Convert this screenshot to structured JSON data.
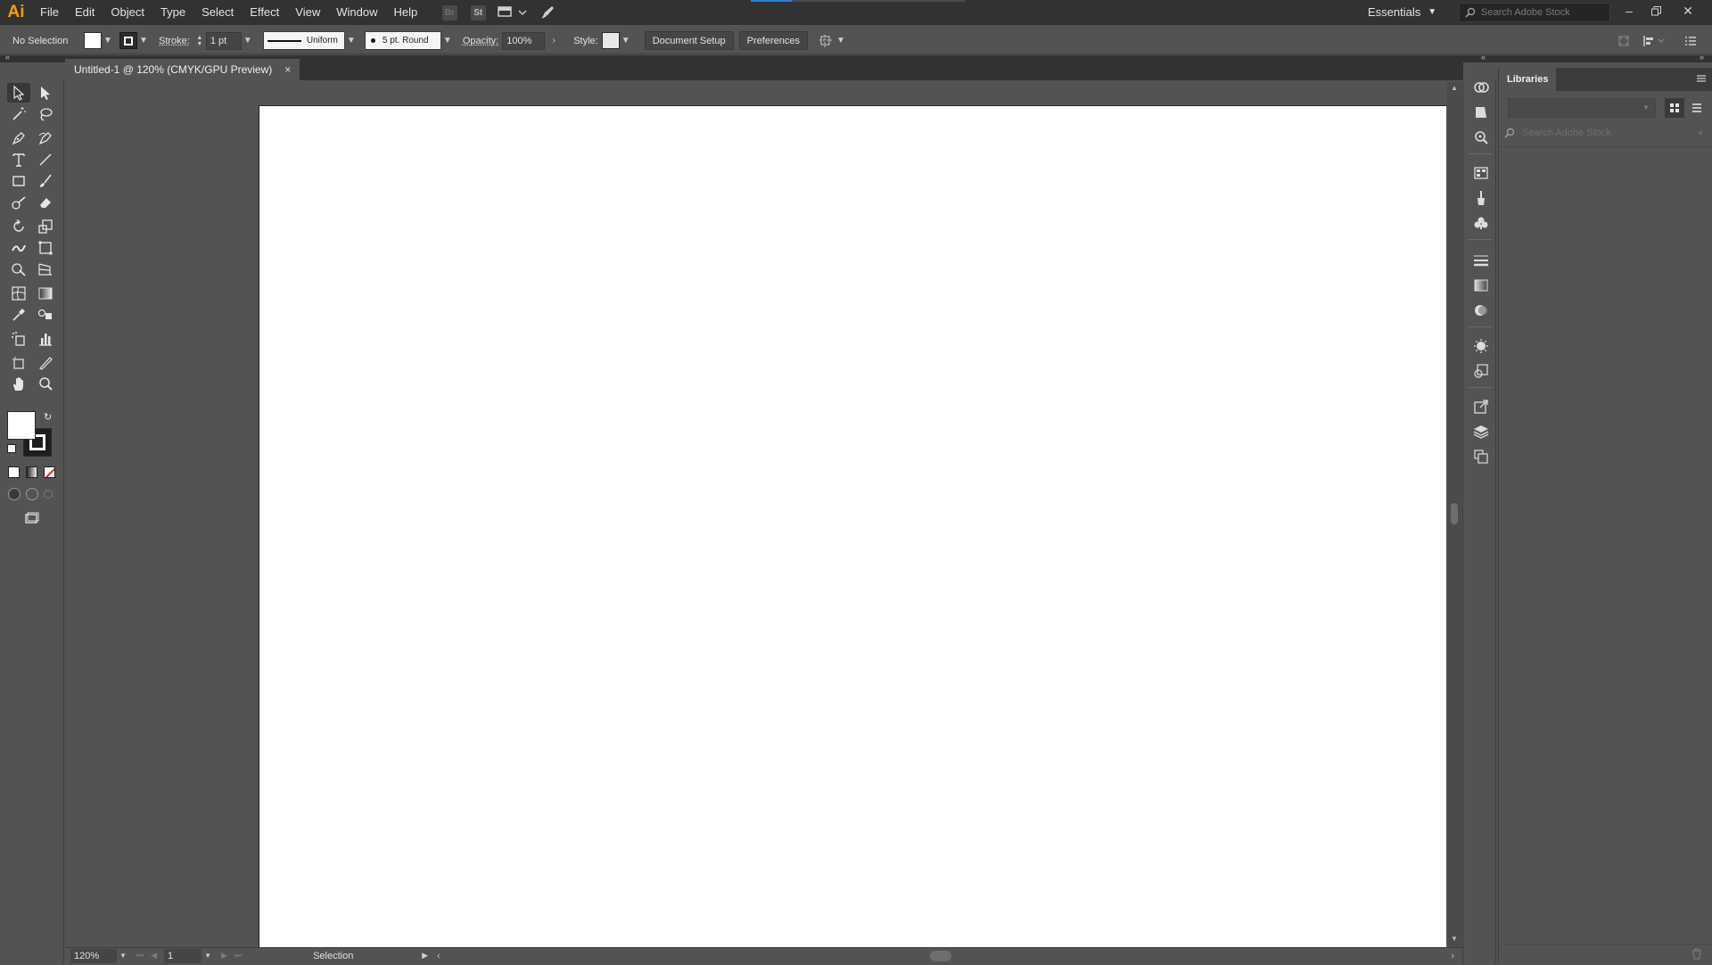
{
  "app": {
    "logo": "Ai"
  },
  "menu": [
    "File",
    "Edit",
    "Object",
    "Type",
    "Select",
    "Effect",
    "View",
    "Window",
    "Help"
  ],
  "menubar_icons": {
    "bridge": "Br",
    "stock": "St"
  },
  "workspace": "Essentials",
  "stock_search": {
    "placeholder": "Search Adobe Stock"
  },
  "control": {
    "selection": "No Selection",
    "stroke_label": "Stroke:",
    "stroke_weight": "1 pt",
    "profile": "Uniform",
    "brush": "5 pt. Round",
    "opacity_label": "Opacity:",
    "opacity": "100%",
    "style_label": "Style:",
    "document_setup": "Document Setup",
    "preferences": "Preferences"
  },
  "document": {
    "tab_title": "Untitled-1 @ 120% (CMYK/GPU Preview)",
    "close": "×"
  },
  "status": {
    "zoom": "120%",
    "artboard": "1",
    "tool": "Selection"
  },
  "libraries": {
    "title": "Libraries",
    "search_placeholder": "Search Adobe Stock"
  },
  "colors": {
    "accent": "#ff9a00",
    "ui_dark": "#323232",
    "ui": "#535353",
    "artboard": "#ffffff"
  }
}
